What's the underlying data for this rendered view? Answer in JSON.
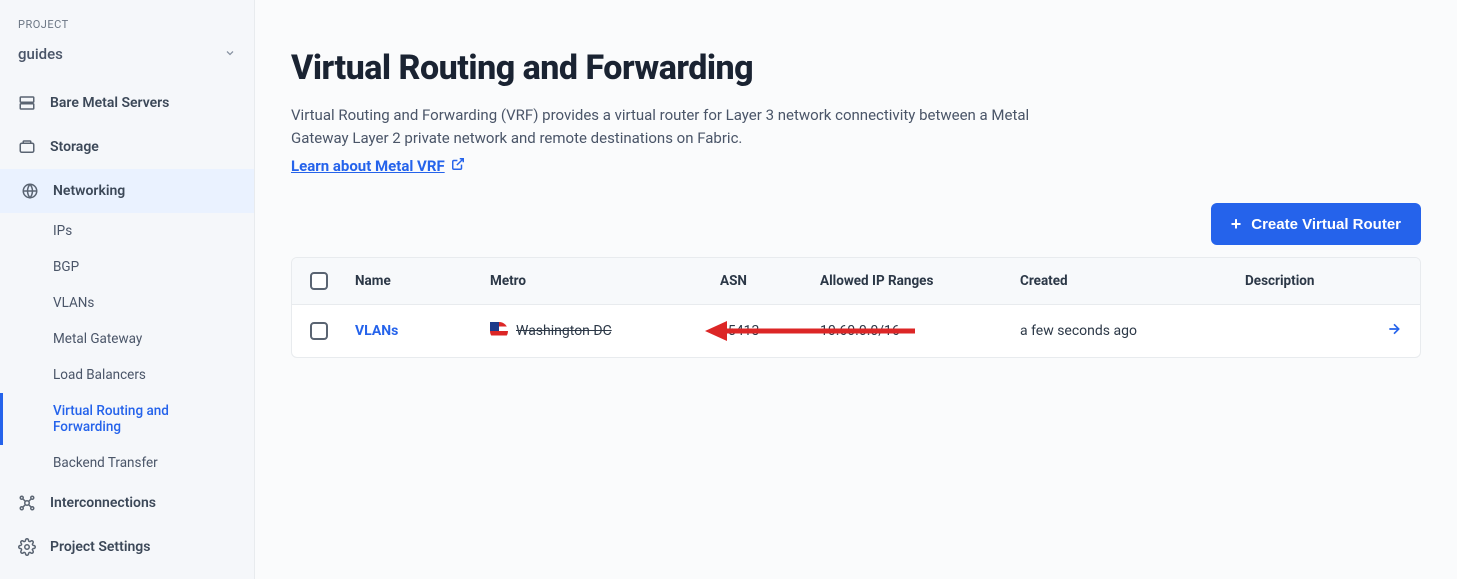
{
  "sidebar": {
    "section_label": "PROJECT",
    "project_name": "guides",
    "items": [
      {
        "label": "Bare Metal Servers"
      },
      {
        "label": "Storage"
      },
      {
        "label": "Networking"
      },
      {
        "label": "Interconnections"
      },
      {
        "label": "Project Settings"
      }
    ],
    "networking_subitems": [
      {
        "label": "IPs"
      },
      {
        "label": "BGP"
      },
      {
        "label": "VLANs"
      },
      {
        "label": "Metal Gateway"
      },
      {
        "label": "Load Balancers"
      },
      {
        "label": "Virtual Routing and Forwarding"
      },
      {
        "label": "Backend Transfer"
      }
    ]
  },
  "page": {
    "title": "Virtual Routing and Forwarding",
    "description": "Virtual Routing and Forwarding (VRF) provides a virtual router for Layer 3 network connectivity between a Metal Gateway Layer 2 private network and remote destinations on Fabric.",
    "learn_link": "Learn about Metal VRF",
    "create_button": "Create Virtual Router"
  },
  "table": {
    "headers": {
      "name": "Name",
      "metro": "Metro",
      "asn": "ASN",
      "allowed": "Allowed IP Ranges",
      "created": "Created",
      "description": "Description"
    },
    "rows": [
      {
        "name": "VLANs",
        "metro": "Washington DC",
        "asn": "65413",
        "allowed": "10.60.0.0/16",
        "created": "a few seconds ago",
        "description": ""
      }
    ]
  }
}
